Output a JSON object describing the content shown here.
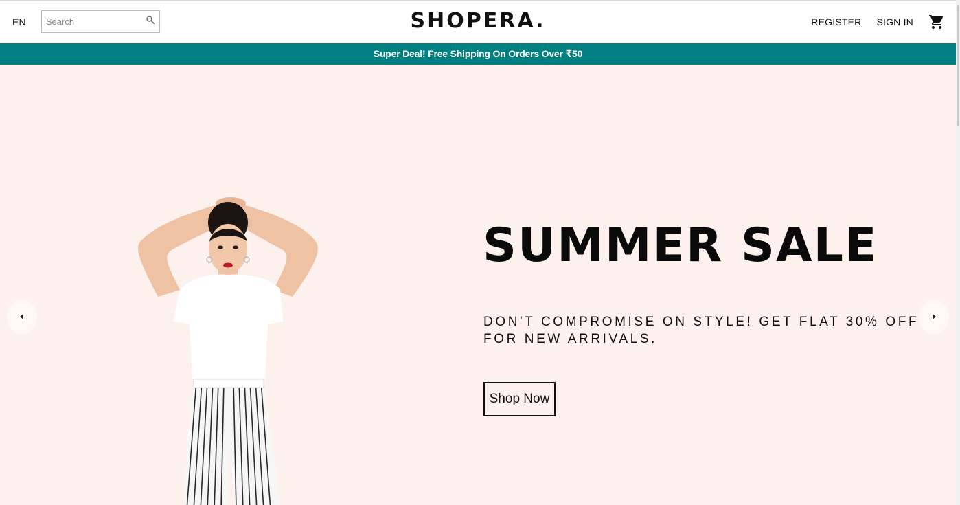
{
  "navbar": {
    "language": "EN",
    "search_placeholder": "Search",
    "logo": "SHOPERA.",
    "register": "REGISTER",
    "sign_in": "SIGN IN",
    "icons": {
      "search": "search-icon",
      "cart": "cart-icon"
    }
  },
  "announcement": {
    "text": "Super Deal! Free Shipping On Orders Over ₹50"
  },
  "hero": {
    "title": "SUMMER SALE",
    "description": "DON'T COMPROMISE ON STYLE! GET FLAT 30% OFF FOR NEW ARRIVALS.",
    "button": "Shop Now",
    "background_color": "#fcf1ed",
    "icons": {
      "prev": "chevron-left-icon",
      "next": "chevron-right-icon"
    }
  },
  "colors": {
    "accent": "#008080",
    "text": "#111111"
  }
}
